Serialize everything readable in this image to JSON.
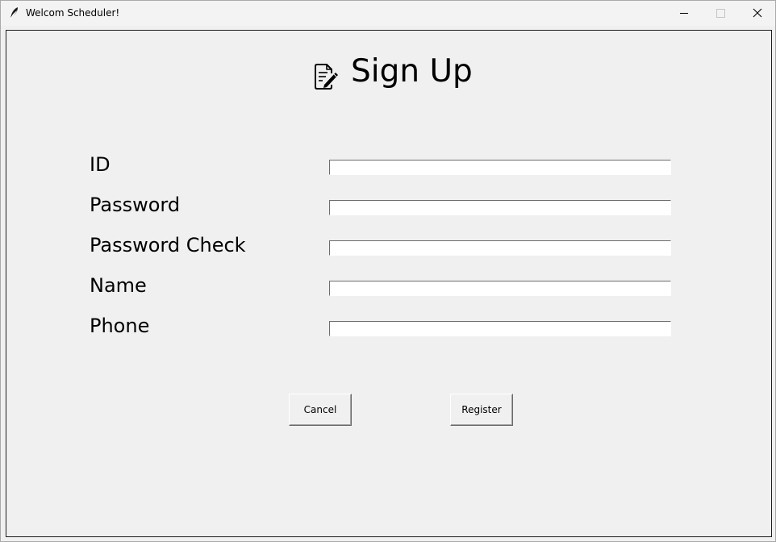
{
  "window": {
    "title": "Welcom Scheduler!",
    "app_icon": "feather-icon",
    "controls": {
      "minimize_icon": "minimize-icon",
      "maximize_icon": "maximize-icon",
      "close_icon": "close-icon"
    }
  },
  "heading": {
    "icon": "edit-document-icon",
    "title": "Sign Up"
  },
  "form": {
    "fields": [
      {
        "label": "ID",
        "value": ""
      },
      {
        "label": "Password",
        "value": ""
      },
      {
        "label": "Password Check",
        "value": ""
      },
      {
        "label": "Name",
        "value": ""
      },
      {
        "label": "Phone",
        "value": ""
      }
    ]
  },
  "buttons": {
    "cancel_label": "Cancel",
    "register_label": "Register"
  }
}
